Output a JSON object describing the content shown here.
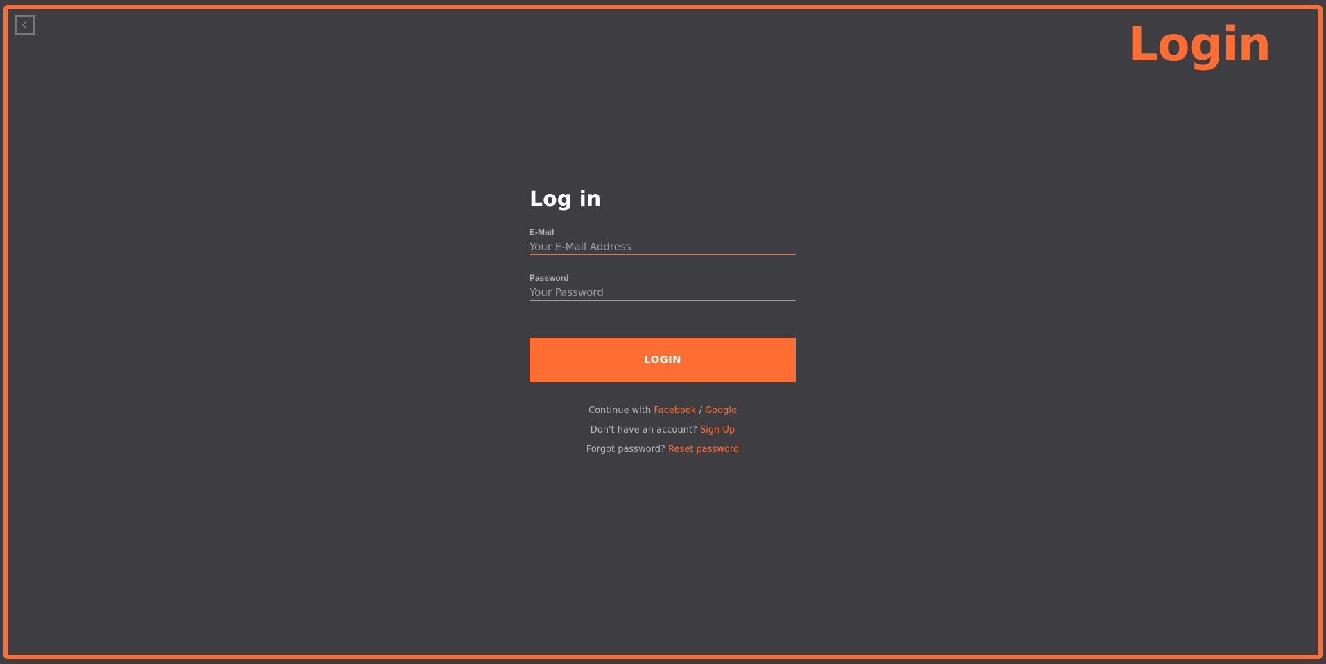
{
  "header": {
    "title": "Login",
    "back_icon": "chevron-left-icon"
  },
  "form": {
    "title": "Log in",
    "email": {
      "label": "E-Mail",
      "placeholder": "Your E-Mail Address",
      "value": ""
    },
    "password": {
      "label": "Password",
      "placeholder": "Your Password",
      "value": ""
    },
    "submit_label": "LOGIN"
  },
  "links": {
    "continue_text": "Continue with",
    "facebook_label": "Facebook",
    "separator": "/",
    "google_label": "Google",
    "signup_prompt": "Don't have an account?",
    "signup_label": "Sign Up",
    "forgot_prompt": "Forgot password?",
    "reset_label": "Reset password"
  },
  "colors": {
    "accent": "#ff6d33",
    "background": "#3e3d42",
    "text_primary": "#ffffff",
    "text_muted": "#b9b8bc"
  }
}
